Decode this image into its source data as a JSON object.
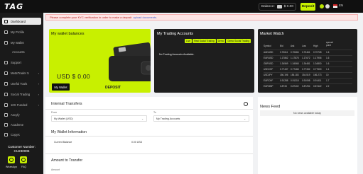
{
  "app": {
    "logo": "TAG"
  },
  "topbar": {
    "balance_label": "Balance:",
    "balance_value": "$ 0.00",
    "deposit_label": "Deposit",
    "language": "EN"
  },
  "banner": {
    "text": "Please complete your KYC verification in order to make a deposit",
    "link": "upload documents."
  },
  "sidebar": {
    "items": [
      {
        "label": "Dashboard",
        "active": true,
        "icon": "dashboard-icon"
      },
      {
        "label": "My Profile",
        "icon": "user-icon"
      },
      {
        "label": "My Wallet",
        "icon": "wallet-icon"
      },
      {
        "label": "Accounts",
        "icon": ""
      },
      {
        "label": "Support",
        "icon": "support-icon"
      },
      {
        "label": "MetaTrader 5",
        "icon": "metatrader-icon"
      },
      {
        "label": "Useful Tools",
        "icon": "tools-icon"
      },
      {
        "label": "Social Trading",
        "icon": "social-trading-icon"
      },
      {
        "label": "10X Funded",
        "icon": "funded-icon"
      },
      {
        "label": "Ascyfy",
        "icon": "ascyfy-icon"
      },
      {
        "label": "Academe",
        "icon": "academe-icon"
      },
      {
        "label": "CopyX",
        "icon": "copyx-icon"
      }
    ],
    "customer_number_label": "Customer Number:",
    "customer_number": "CU230006",
    "whatsapp_label": "WhatsApp",
    "faq_label": "FAQ"
  },
  "wallet": {
    "title": "My wallet balances",
    "amount": "USD $ 0.00",
    "button": "My Wallet",
    "deposit": "DEPOSIT"
  },
  "trading": {
    "title": "My Trading Accounts",
    "tabs": [
      "Live",
      "Real Social Trading",
      "Demo",
      "Demo Social Trading"
    ],
    "empty": "No Trading Accounts Available."
  },
  "market": {
    "title": "Market Watch",
    "columns": [
      "Symbol",
      "Bid",
      "Ask",
      "Low",
      "High",
      "spread point"
    ],
    "rows": [
      [
        "AUDUSD",
        "0.70611",
        "0.70666",
        "0.70461",
        "0.70728",
        "1.6"
      ],
      [
        "EURUSD",
        "1.17862",
        "1.17878",
        "1.17672",
        "1.17906",
        "1.6"
      ],
      [
        "GBPUSD",
        "1.34569",
        "1.34568",
        "1.34481",
        "1.34800",
        "1.6"
      ],
      [
        "USDCHF",
        "0.77437",
        "0.77468",
        "0.77332",
        "0.77500",
        "1.1"
      ],
      [
        "USDJPY",
        "156.196",
        "156.183",
        "154.519",
        "156.273",
        "10"
      ],
      [
        "EURCHF",
        "0.91288",
        "0.91318",
        "0.91098",
        "0.91411",
        "1.7"
      ],
      [
        "EURGBP",
        "0.8733",
        "0.87402",
        "0.87294",
        "0.87422",
        "2.2"
      ]
    ]
  },
  "transfers": {
    "title": "Internal Transfers",
    "from_label": "From",
    "from_value": "My Wallet (USD)",
    "to_label": "To",
    "to_value": "My Trading Accounts",
    "wallet_info_title": "My Wallet Information",
    "current_balance_label": "Current Balance",
    "current_balance_value": "0.00 USD",
    "amount_title": "Amount to Transfer",
    "amount_label": "Amount"
  },
  "news": {
    "title": "News Feed",
    "empty": "No news available today"
  },
  "colors": {
    "accent": "#c8f000",
    "dark_panel": "#1e1e1e",
    "sidebar": "#1a1a1a",
    "banner_bg": "#fde4e4",
    "link": "#4463d6"
  }
}
